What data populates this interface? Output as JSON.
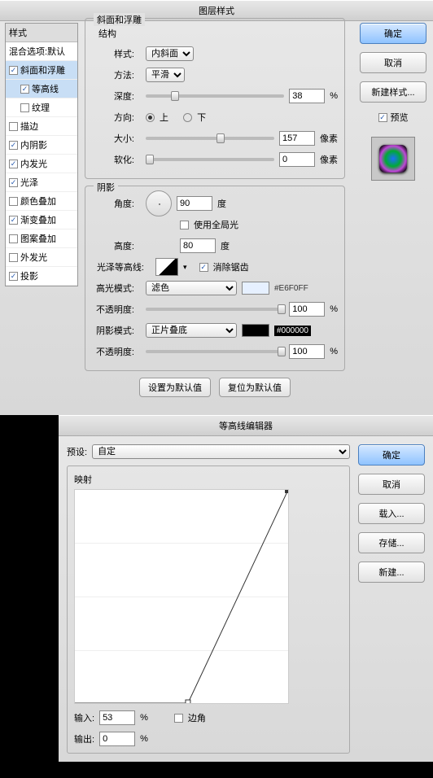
{
  "dlg1": {
    "title": "图层样式",
    "sidebar": {
      "header": "样式",
      "blend": "混合选项:默认",
      "items": [
        {
          "label": "斜面和浮雕",
          "checked": true,
          "selected": true
        },
        {
          "label": "等高线",
          "checked": true,
          "sub": true,
          "selected": true
        },
        {
          "label": "纹理",
          "checked": false,
          "sub": true
        },
        {
          "label": "描边",
          "checked": false
        },
        {
          "label": "内阴影",
          "checked": true
        },
        {
          "label": "内发光",
          "checked": true
        },
        {
          "label": "光泽",
          "checked": true
        },
        {
          "label": "颜色叠加",
          "checked": false
        },
        {
          "label": "渐变叠加",
          "checked": true
        },
        {
          "label": "图案叠加",
          "checked": false
        },
        {
          "label": "外发光",
          "checked": false
        },
        {
          "label": "投影",
          "checked": true
        }
      ]
    },
    "right": {
      "ok": "确定",
      "cancel": "取消",
      "newstyle": "新建样式...",
      "preview": "预览"
    },
    "bevel": {
      "title": "斜面和浮雕",
      "struct": "结构",
      "style_l": "样式:",
      "style_v": "内斜面",
      "tech_l": "方法:",
      "tech_v": "平滑",
      "depth_l": "深度:",
      "depth_v": "38",
      "pct": "%",
      "dir_l": "方向:",
      "up": "上",
      "down": "下",
      "size_l": "大小:",
      "size_v": "157",
      "px": "像素",
      "soft_l": "软化:",
      "soft_v": "0"
    },
    "shade": {
      "title": "阴影",
      "angle_l": "角度:",
      "angle_v": "90",
      "deg": "度",
      "global": "使用全局光",
      "alt_l": "高度:",
      "alt_v": "80",
      "gloss_l": "光泽等高线:",
      "anti": "消除锯齿",
      "hi_l": "高光模式:",
      "hi_v": "滤色",
      "hi_hex": "#E6F0FF",
      "op_l": "不透明度:",
      "hi_op": "100",
      "sh_l": "阴影模式:",
      "sh_v": "正片叠底",
      "sh_hex": "#000000",
      "sh_op": "100"
    },
    "footer": {
      "setdef": "设置为默认值",
      "reset": "复位为默认值"
    }
  },
  "dlg2": {
    "title": "等高线编辑器",
    "preset_l": "预设:",
    "preset_v": "自定",
    "map": "映射",
    "in_l": "输入:",
    "in_v": "53",
    "pct": "%",
    "out_l": "输出:",
    "out_v": "0",
    "corner": "边角",
    "btns": {
      "ok": "确定",
      "cancel": "取消",
      "load": "载入...",
      "save": "存储...",
      "new": "新建..."
    }
  }
}
